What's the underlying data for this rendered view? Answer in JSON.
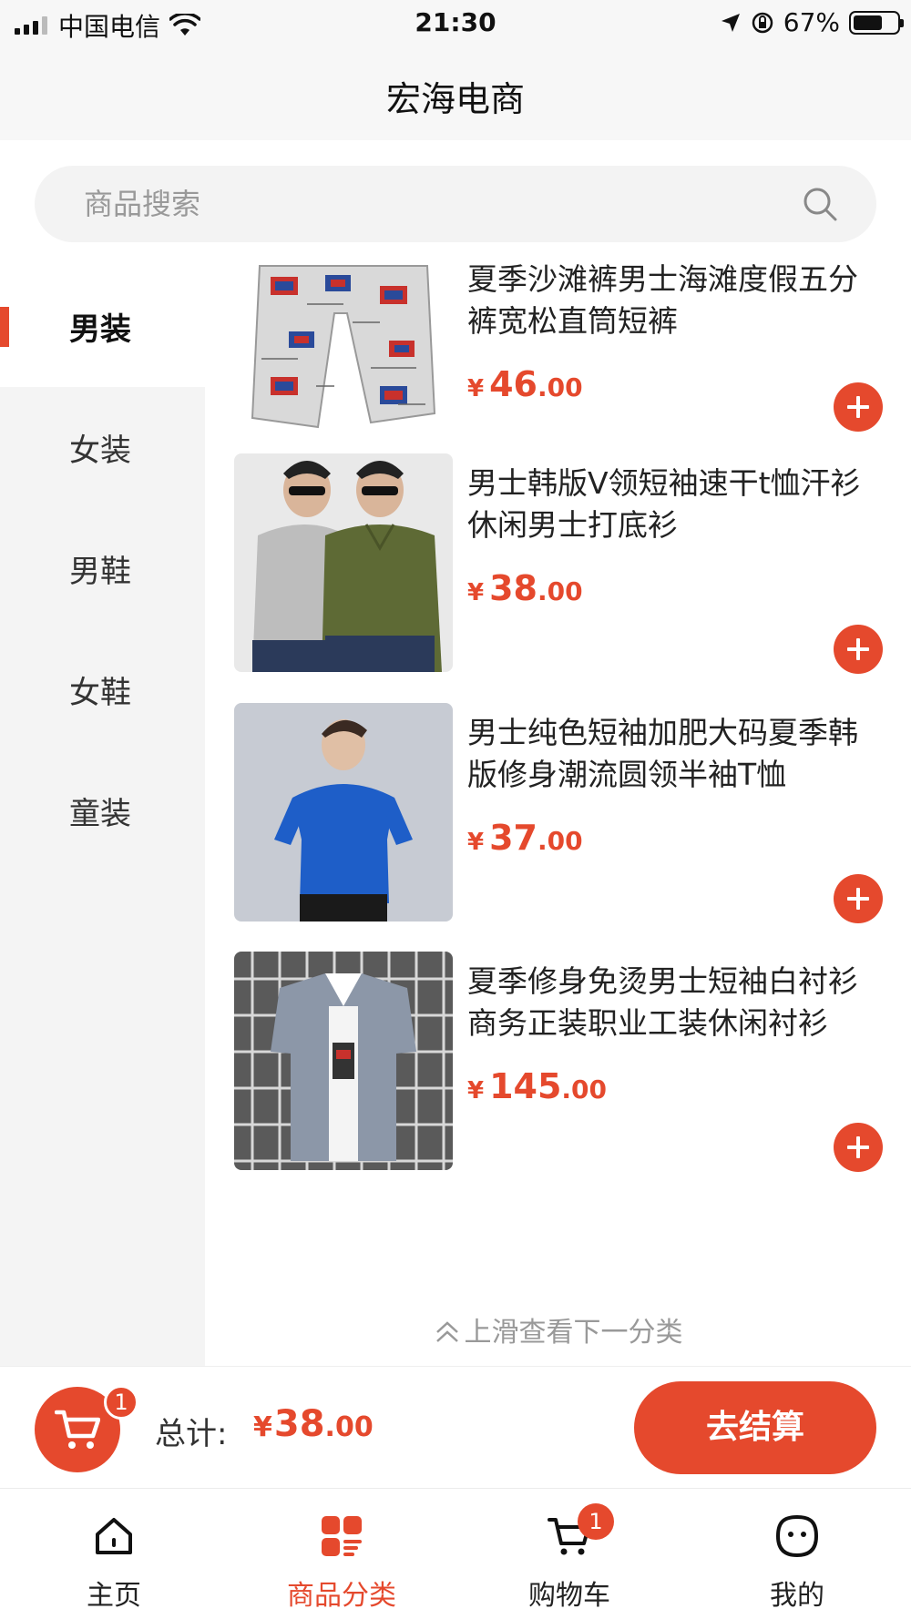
{
  "status_bar": {
    "carrier": "中国电信",
    "time": "21:30",
    "battery": "67%",
    "battery_level": 0.67,
    "icons": [
      "signal-icon",
      "wifi-icon",
      "location-arrow-icon",
      "rotation-lock-icon",
      "battery-icon"
    ]
  },
  "header": {
    "title": "宏海电商"
  },
  "search": {
    "placeholder": "商品搜索",
    "icon": "search-icon"
  },
  "sidebar": {
    "items": [
      {
        "label": "男装",
        "active": true
      },
      {
        "label": "女装"
      },
      {
        "label": "男鞋"
      },
      {
        "label": "女鞋"
      },
      {
        "label": "童装"
      }
    ]
  },
  "products": [
    {
      "title": "夏季沙滩裤男士海滩度假五分裤宽松直筒短裤",
      "currency": "¥",
      "price_int": "46",
      "price_dec": ".00",
      "image": "printed-beach-shorts"
    },
    {
      "title": "男士韩版V领短袖速干t恤汗衫休闲男士打底衫",
      "currency": "¥",
      "price_int": "38",
      "price_dec": ".00",
      "image": "v-neck-tshirts"
    },
    {
      "title": "男士纯色短袖加肥大码夏季韩版修身潮流圆领半袖T恤",
      "currency": "¥",
      "price_int": "37",
      "price_dec": ".00",
      "image": "blue-tshirt"
    },
    {
      "title": "夏季修身免烫男士短袖白衬衫商务正装职业工装休闲衬衫",
      "currency": "¥",
      "price_int": "145",
      "price_dec": ".00",
      "image": "grey-shirt"
    }
  ],
  "next_hint": "上滑查看下一分类",
  "cart_bar": {
    "badge": "1",
    "total_label": "总计:",
    "currency": "¥",
    "total_int": "38",
    "total_dec": ".00",
    "checkout_label": "去结算"
  },
  "tabbar": {
    "items": [
      {
        "label": "主页",
        "icon": "home-icon"
      },
      {
        "label": "商品分类",
        "icon": "category-icon",
        "active": true
      },
      {
        "label": "购物车",
        "icon": "cart-icon",
        "badge": "1"
      },
      {
        "label": "我的",
        "icon": "profile-icon"
      }
    ]
  },
  "colors": {
    "accent": "#e5492d",
    "sidebar_bg": "#f4f4f4",
    "header_bg": "#f7f7f7"
  }
}
